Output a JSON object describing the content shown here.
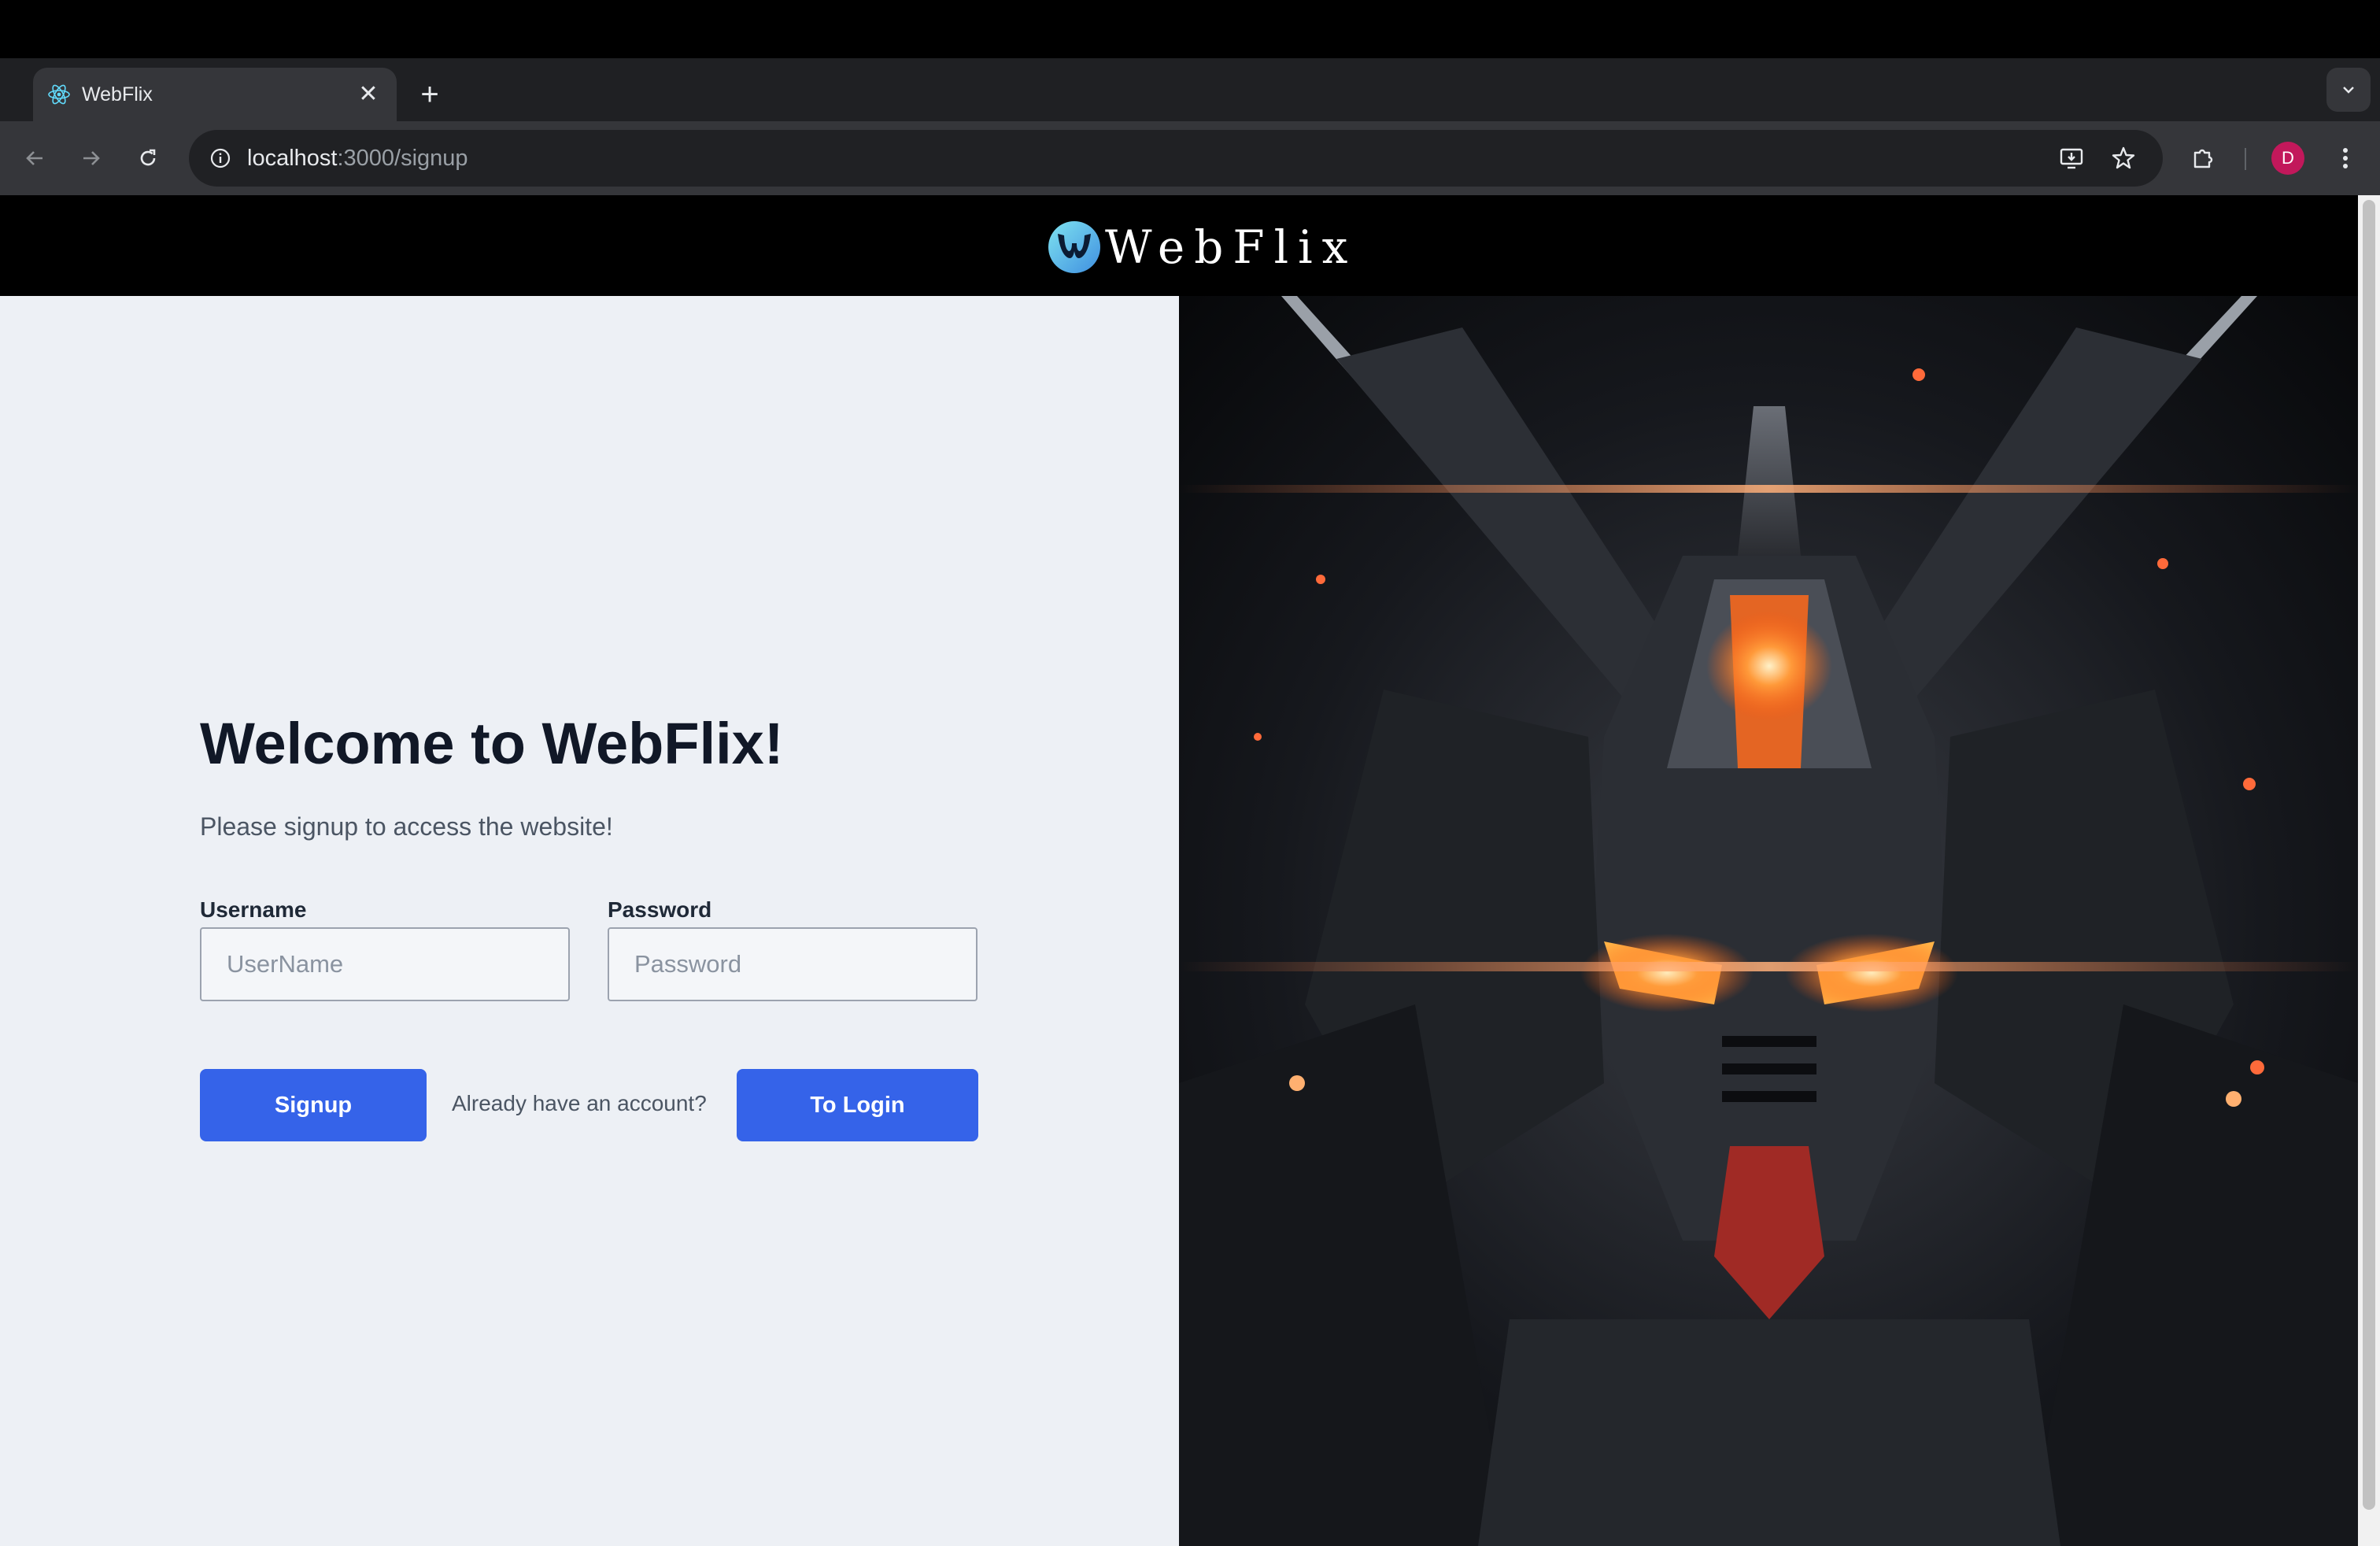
{
  "browser": {
    "tab_title": "WebFlix",
    "url_host": "localhost",
    "url_rest": ":3000/signup",
    "profile_initial": "D"
  },
  "site": {
    "logo_text": "WebFlix"
  },
  "signup": {
    "heading": "Welcome to WebFlix!",
    "subtext": "Please signup to access the website!",
    "username_label": "Username",
    "username_placeholder": "UserName",
    "username_value": "",
    "password_label": "Password",
    "password_placeholder": "Password",
    "password_value": "",
    "signup_button": "Signup",
    "account_hint": "Already have an account?",
    "login_button": "To Login"
  },
  "colors": {
    "accent": "#3563e9",
    "page_background": "#edf0f5",
    "header_background": "#000000"
  },
  "icons": [
    "react-favicon",
    "close-icon",
    "plus-icon",
    "chevron-down-icon",
    "back-arrow-icon",
    "forward-arrow-icon",
    "reload-icon",
    "site-info-icon",
    "install-app-icon",
    "bookmark-star-icon",
    "extensions-icon",
    "more-vert-icon",
    "webflix-logo-icon",
    "mecha-robot-image"
  ]
}
